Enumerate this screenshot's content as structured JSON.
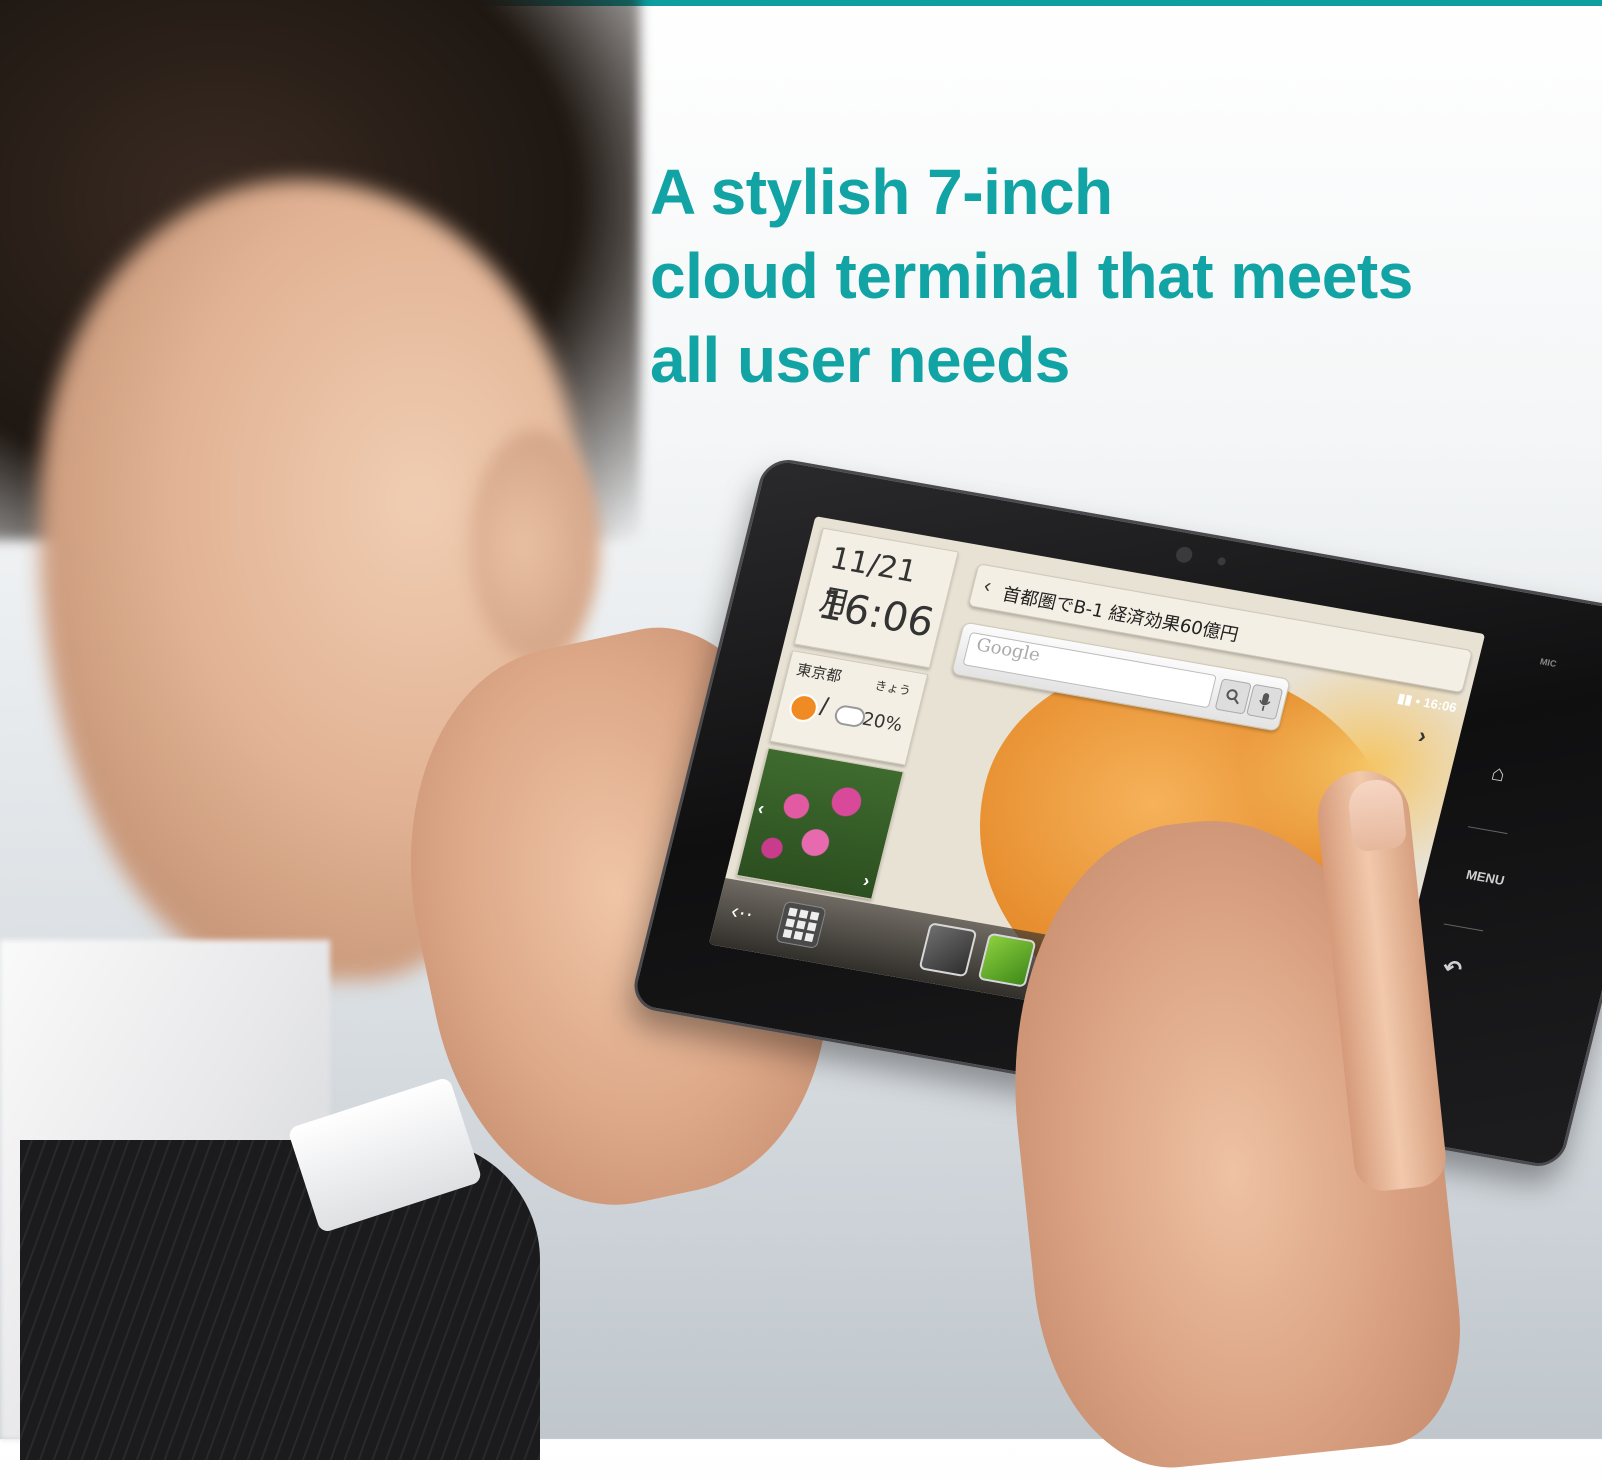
{
  "headline": {
    "line1": "A stylish 7-inch",
    "line2": "cloud terminal that meets",
    "line3": "all user needs"
  },
  "tablet_screen": {
    "clock_widget": {
      "date": "11/21 月",
      "time": "16:06"
    },
    "weather_widget": {
      "city": "東京都",
      "day": "きょう",
      "rain_chance": "20%"
    },
    "news_ticker": "首都圏でB-1 経済効果60億円",
    "search": {
      "placeholder": "Google"
    },
    "status_time": "16:06",
    "dock_apps": [
      "contacts-icon",
      "messages-icon",
      "browser-icon",
      "email-icon"
    ]
  },
  "hardware_keys": {
    "menu": "MENU",
    "mic": "MIC"
  },
  "colors": {
    "headline": "#12a3a4",
    "top_bar": "#0c9fa0"
  }
}
